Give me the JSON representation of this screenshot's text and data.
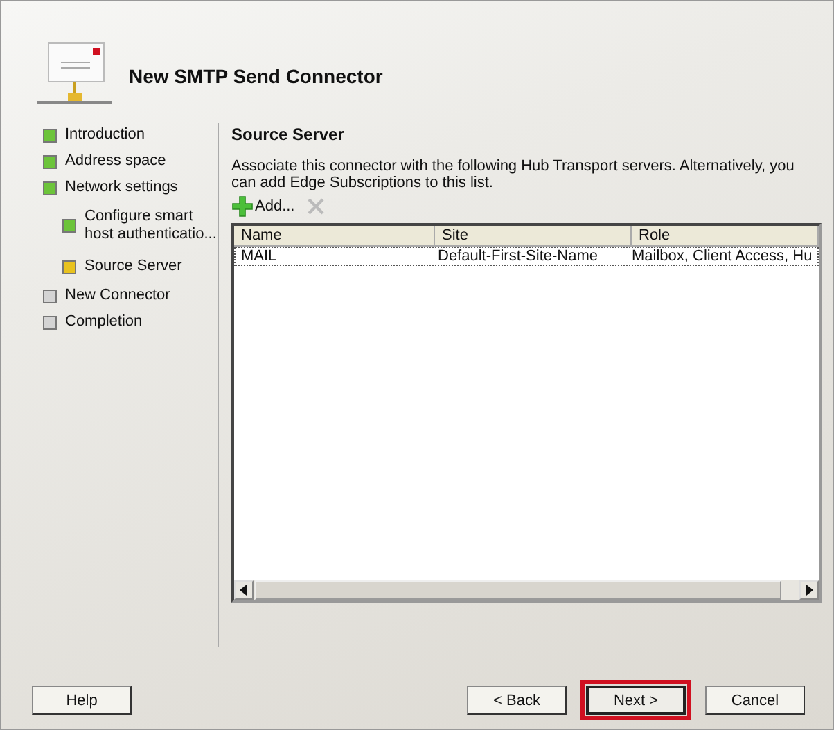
{
  "wizard": {
    "title": "New SMTP Send Connector"
  },
  "steps": [
    {
      "label": "Introduction",
      "kind": "done"
    },
    {
      "label": "Address space",
      "kind": "done"
    },
    {
      "label": "Network settings",
      "kind": "done",
      "children": [
        {
          "label": "Configure smart host authenticatio...",
          "kind": "done"
        },
        {
          "label": "Source Server",
          "kind": "current"
        }
      ]
    },
    {
      "label": "New Connector",
      "kind": "pending"
    },
    {
      "label": "Completion",
      "kind": "pending"
    }
  ],
  "page": {
    "heading": "Source Server",
    "description": "Associate this connector with the following Hub Transport servers. Alternatively, you can add Edge Subscriptions to this list.",
    "toolbar": [
      {
        "kind": "add",
        "label": "Add...",
        "disabled": false
      },
      {
        "kind": "remove",
        "disabled": true
      }
    ],
    "table": {
      "columns": [
        "Name",
        "Site",
        "Role"
      ],
      "rows": [
        {
          "cells": [
            "MAIL",
            "Default-First-Site-Name",
            "Mailbox, Client Access, Hu"
          ],
          "selected": true
        }
      ]
    }
  },
  "buttons": [
    {
      "label": "Help",
      "highlighted": false
    },
    {
      "label": "< Back",
      "highlighted": false
    },
    {
      "label": "Next >",
      "highlighted": true
    },
    {
      "label": "Cancel",
      "highlighted": false
    }
  ]
}
